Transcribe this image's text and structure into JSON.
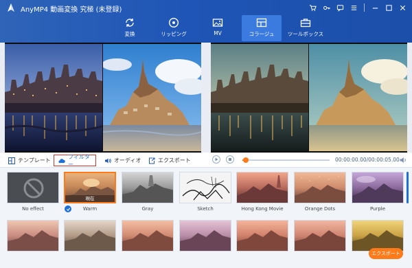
{
  "app": {
    "title": "AnyMP4 動画変換 究極 (未登録)",
    "accent": "#1f55b6",
    "active_tab_color": "#3b7be0"
  },
  "window_controls": [
    "cart-icon",
    "key-icon",
    "feedback-icon",
    "menu-icon",
    "minimize-icon",
    "maximize-icon",
    "close-icon"
  ],
  "nav": {
    "tabs": [
      {
        "label": "変換",
        "icon": "convert-icon",
        "active": false
      },
      {
        "label": "リッピング",
        "icon": "disc-icon",
        "active": false
      },
      {
        "label": "MV",
        "icon": "mv-icon",
        "active": false
      },
      {
        "label": "コラージュ",
        "icon": "collage-icon",
        "active": true
      },
      {
        "label": "ツールボックス",
        "icon": "toolbox-icon",
        "active": false
      }
    ]
  },
  "toolbar": {
    "tabs": [
      {
        "label": "テンプレート",
        "icon": "template-icon",
        "active": false
      },
      {
        "label": "フィルター",
        "icon": "cloud-filter-icon",
        "active": true
      },
      {
        "label": "オーディオ",
        "icon": "speaker-icon",
        "active": false
      },
      {
        "label": "エクスポート",
        "icon": "export-icon",
        "active": false
      }
    ]
  },
  "player": {
    "timecode": "00:00:00.00/00:00:05.00",
    "progress": 0.04,
    "progress_color": "#ff7a18"
  },
  "filters": {
    "current_label": "現在",
    "selected": "Warm",
    "items_row1": [
      "No effect",
      "Warm",
      "Gray",
      "Sketch",
      "Hong Kong Movie",
      "Orange Dots",
      "Purple"
    ],
    "items_row2_count": 7
  },
  "export_button": {
    "label": "エクスポート",
    "color": "#ff7a18"
  }
}
